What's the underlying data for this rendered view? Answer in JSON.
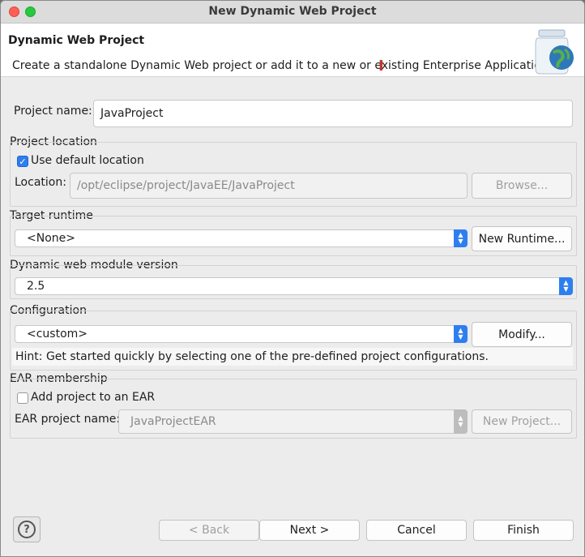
{
  "window": {
    "title": "New Dynamic Web Project"
  },
  "banner": {
    "heading": "Dynamic Web Project",
    "description": "Create a standalone Dynamic Web project or add it to a new or existing Enterprise Application."
  },
  "project_name": {
    "label": "Project name:",
    "value": "JavaProject"
  },
  "project_location": {
    "group_label": "Project location",
    "use_default_label": "Use default location",
    "use_default_checked": true,
    "location_label": "Location:",
    "location_value": "/opt/eclipse/project/JavaEE/JavaProject",
    "browse_label": "Browse..."
  },
  "target_runtime": {
    "group_label": "Target runtime",
    "selected": "<None>",
    "new_runtime_label": "New Runtime..."
  },
  "module_version": {
    "group_label": "Dynamic web module version",
    "selected": "2.5"
  },
  "configuration": {
    "group_label": "Configuration",
    "selected": "<custom>",
    "modify_label": "Modify...",
    "hint": "Hint: Get started quickly by selecting one of the pre-defined project configurations."
  },
  "ear": {
    "group_label": "EAR membership",
    "add_label": "Add project to an EAR",
    "add_checked": false,
    "project_name_label": "EAR project name:",
    "project_name_value": "JavaProjectEAR",
    "new_project_label": "New Project..."
  },
  "footer": {
    "help_glyph": "?",
    "back_label": "< Back",
    "next_label": "Next >",
    "cancel_label": "Cancel",
    "finish_label": "Finish"
  }
}
